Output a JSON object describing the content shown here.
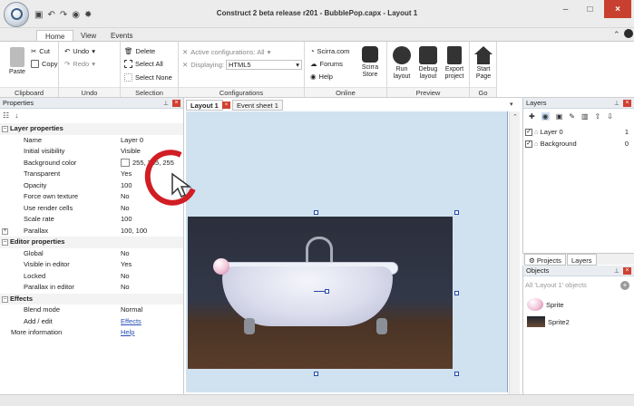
{
  "window": {
    "title": "Construct 2 beta release r201 - BubblePop.capx - Layout 1",
    "minimize": "–",
    "maximize": "□",
    "close": "×"
  },
  "ribbon_tabs": [
    "Home",
    "View",
    "Events"
  ],
  "ribbon": {
    "clipboard": {
      "label": "Clipboard",
      "paste": "Paste",
      "cut": "Cut",
      "copy": "Copy"
    },
    "undo": {
      "label": "Undo",
      "undo": "Undo",
      "redo": "Redo"
    },
    "selection": {
      "label": "Selection",
      "delete": "Delete",
      "select_all": "Select All",
      "select_none": "Select None"
    },
    "configurations": {
      "label": "Configurations",
      "active": "Active configurations: All",
      "displaying_label": "Displaying:",
      "displaying_value": "HTML5"
    },
    "online": {
      "label": "Online",
      "scirra": "Scirra.com",
      "forums": "Forums",
      "help": "Help",
      "store": "Scirra Store"
    },
    "preview": {
      "label": "Preview",
      "run": "Run layout",
      "debug": "Debug layout",
      "export": "Export project"
    },
    "go": {
      "label": "Go",
      "start": "Start Page"
    }
  },
  "properties": {
    "title": "Properties",
    "rows": [
      {
        "key": "Layer properties",
        "cat": true,
        "tog": "–"
      },
      {
        "key": "Name",
        "value": "Layer 0"
      },
      {
        "key": "Initial visibility",
        "value": "Visible"
      },
      {
        "key": "Background color",
        "value": "255, 255, 255"
      },
      {
        "key": "Transparent",
        "value": "Yes"
      },
      {
        "key": "Opacity",
        "value": "100"
      },
      {
        "key": "Force own texture",
        "value": "No"
      },
      {
        "key": "Use render cells",
        "value": "No"
      },
      {
        "key": "Scale rate",
        "value": "100"
      },
      {
        "key": "Parallax",
        "value": "100, 100",
        "tog": "+"
      },
      {
        "key": "Editor properties",
        "cat": true,
        "tog": "–"
      },
      {
        "key": "Global",
        "value": "No"
      },
      {
        "key": "Visible in editor",
        "value": "Yes"
      },
      {
        "key": "Locked",
        "value": "No"
      },
      {
        "key": "Parallax in editor",
        "value": "No"
      },
      {
        "key": "Effects",
        "cat": true,
        "tog": "–"
      },
      {
        "key": "Blend mode",
        "value": "Normal"
      },
      {
        "key": "Add / edit",
        "value": "Effects",
        "link": true
      },
      {
        "key": "More information",
        "value": "Help",
        "link": true,
        "top": true
      }
    ]
  },
  "doc_tabs": {
    "layout": "Layout 1",
    "events": "Event sheet 1"
  },
  "layers_panel": {
    "title": "Layers",
    "items": [
      {
        "name": "Layer 0",
        "n": "1"
      },
      {
        "name": "Background",
        "n": "0"
      }
    ]
  },
  "project_tabs": [
    "Projects",
    "Layers"
  ],
  "objects_panel": {
    "title": "Objects",
    "filter": "All 'Layout 1' objects",
    "items": [
      "Sprite",
      "Sprite2"
    ]
  }
}
